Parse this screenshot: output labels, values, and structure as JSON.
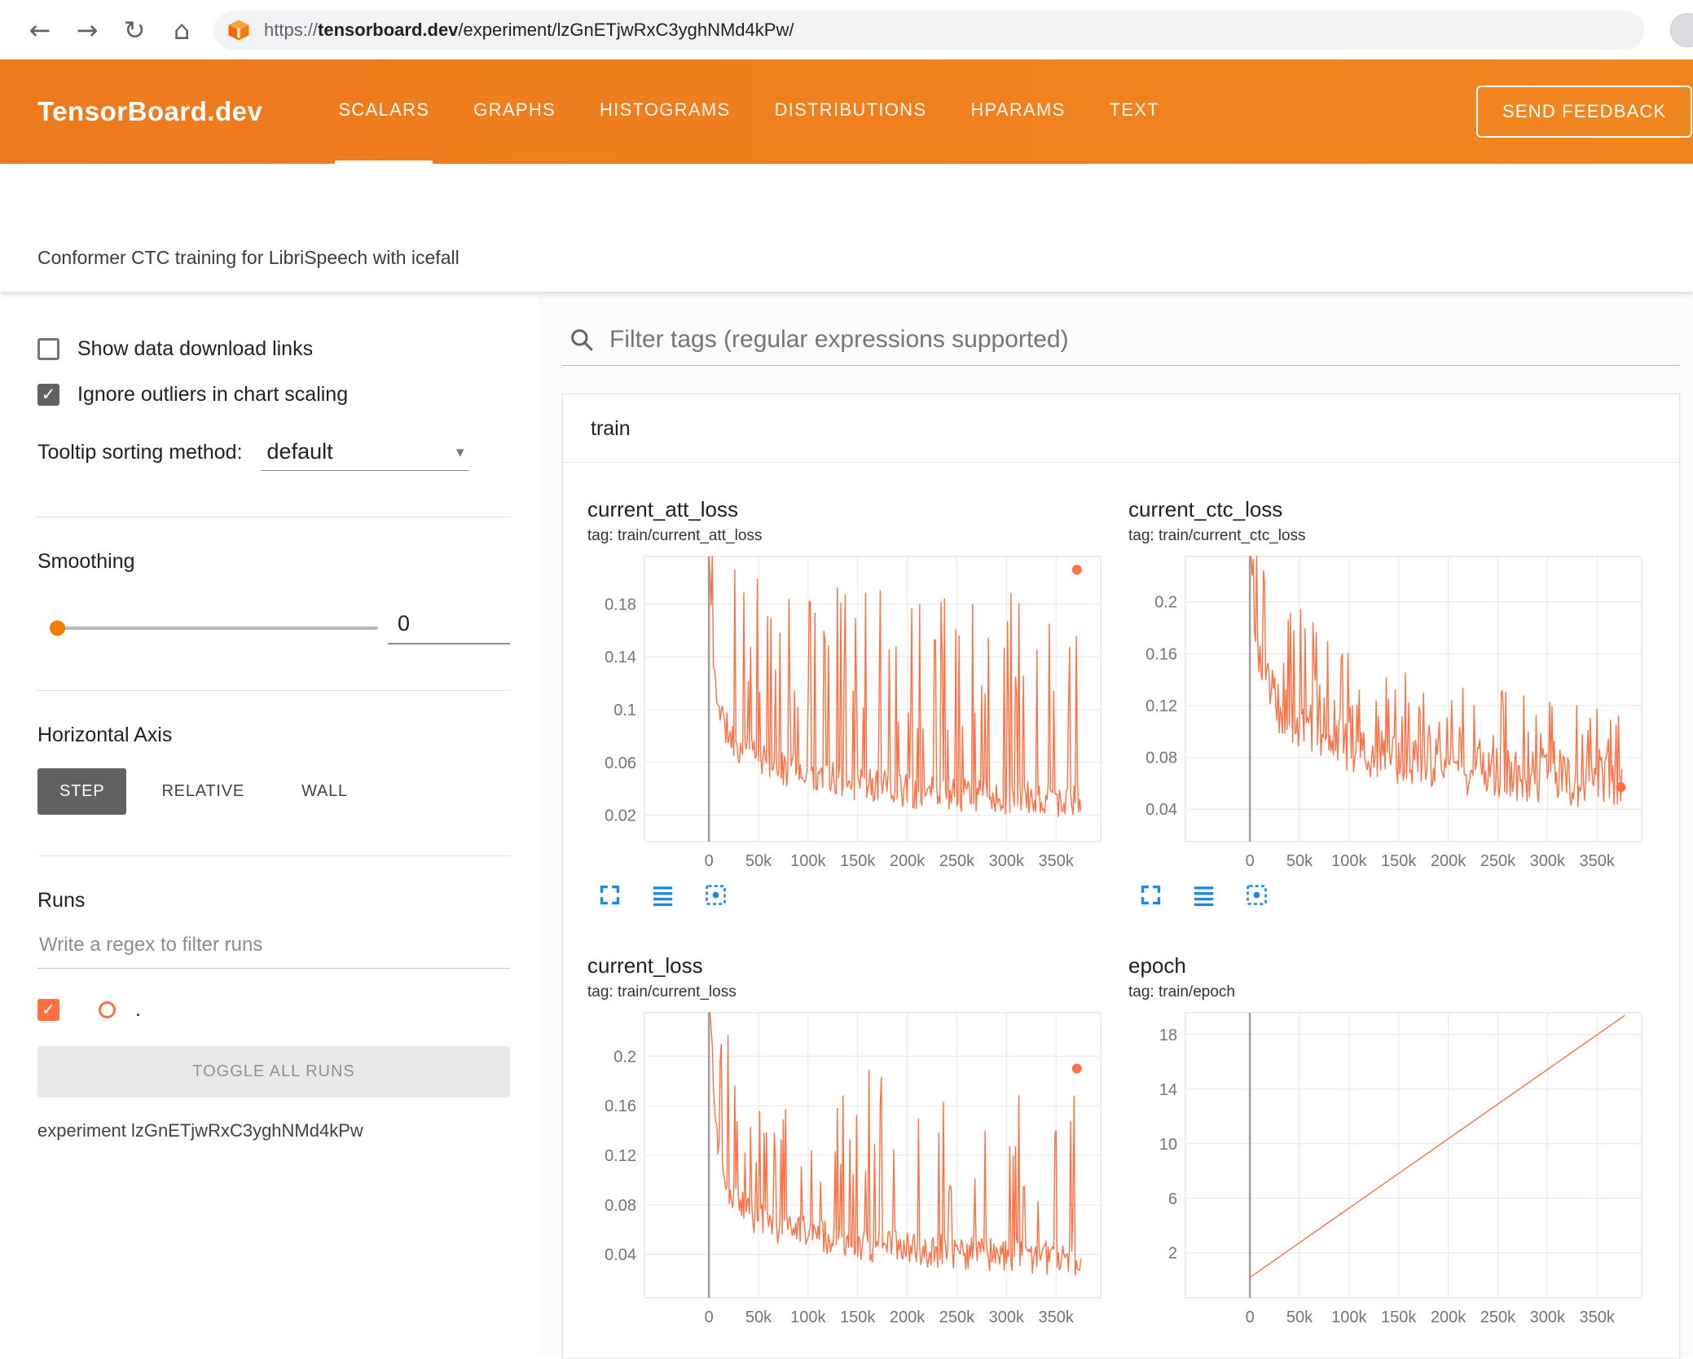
{
  "browser": {
    "back": "←",
    "forward": "→",
    "reload": "↻",
    "home": "⌂",
    "url_scheme": "https://",
    "url_domain": "tensorboard.dev",
    "url_path": "/experiment/lzGnETjwRxC3yghNMd4kPw/"
  },
  "header": {
    "logo": "TensorBoard.dev",
    "tabs": [
      {
        "label": "SCALARS",
        "active": true
      },
      {
        "label": "GRAPHS",
        "active": false
      },
      {
        "label": "HISTOGRAMS",
        "active": false
      },
      {
        "label": "DISTRIBUTIONS",
        "active": false
      },
      {
        "label": "HPARAMS",
        "active": false
      },
      {
        "label": "TEXT",
        "active": false
      }
    ],
    "feedback_button": "SEND FEEDBACK"
  },
  "experiment_title": "Conformer CTC training for LibriSpeech with icefall",
  "sidebar": {
    "show_download_label": "Show data download links",
    "show_download_checked": false,
    "ignore_outliers_label": "Ignore outliers in chart scaling",
    "ignore_outliers_checked": true,
    "tooltip_label": "Tooltip sorting method:",
    "tooltip_value": "default",
    "dropdown_caret": "▾",
    "smoothing_label": "Smoothing",
    "smoothing_value": "0",
    "axis_label": "Horizontal Axis",
    "axis_options": [
      {
        "label": "STEP",
        "selected": true
      },
      {
        "label": "RELATIVE",
        "selected": false
      },
      {
        "label": "WALL",
        "selected": false
      }
    ],
    "runs_label": "Runs",
    "runs_filter_placeholder": "Write a regex to filter runs",
    "run_checked": true,
    "run_name": ".",
    "toggle_all_label": "TOGGLE ALL RUNS",
    "experiment_caption": "experiment lzGnETjwRxC3yghNMd4kPw"
  },
  "main": {
    "filter_placeholder": "Filter tags (regular expressions supported)",
    "group_title": "train",
    "chart_toolbar_icons": [
      "expand-icon",
      "data-rows-icon",
      "fit-domain-icon"
    ]
  },
  "colors": {
    "header_orange": "#f0811f",
    "run_color": "#ff7043",
    "toolbar_icon_blue": "#1e88e5",
    "grid_line": "#e6e6e6",
    "zero_axis": "#9e9e9e",
    "tick_text": "#757575"
  },
  "chart_data": [
    {
      "type": "line",
      "title": "current_att_loss",
      "tag": "tag: train/current_att_loss",
      "x_tick_labels": [
        "0",
        "50k",
        "100k",
        "150k",
        "200k",
        "250k",
        "300k",
        "350k"
      ],
      "x_tick_values": [
        0,
        50000,
        100000,
        150000,
        200000,
        250000,
        300000,
        350000
      ],
      "x_domain": [
        -65000,
        395000
      ],
      "y_tick_labels": [
        "0.18",
        "0.14",
        "0.1",
        "0.06",
        "0.02"
      ],
      "y_tick_values": [
        0.18,
        0.14,
        0.1,
        0.06,
        0.02
      ],
      "y_domain": [
        0.0,
        0.216
      ],
      "series": {
        "name": "train",
        "color": "#ff7043",
        "x_end": 375000,
        "n": 330,
        "seed": 11,
        "baseline": [
          [
            0,
            0.22
          ],
          [
            5000,
            0.12
          ],
          [
            15000,
            0.085
          ],
          [
            30000,
            0.068
          ],
          [
            60000,
            0.055
          ],
          [
            100000,
            0.047
          ],
          [
            150000,
            0.04
          ],
          [
            220000,
            0.033
          ],
          [
            300000,
            0.03
          ],
          [
            375000,
            0.027
          ]
        ],
        "spike_amp": [
          [
            0,
            0.13
          ],
          [
            20000,
            0.15
          ],
          [
            375000,
            0.17
          ]
        ],
        "spike_prob": 0.17,
        "jitter": 0.013,
        "end_dot": [
          371000,
          0.206
        ]
      }
    },
    {
      "type": "line",
      "title": "current_ctc_loss",
      "tag": "tag: train/current_ctc_loss",
      "x_tick_labels": [
        "0",
        "50k",
        "100k",
        "150k",
        "200k",
        "250k",
        "300k",
        "350k"
      ],
      "x_tick_values": [
        0,
        50000,
        100000,
        150000,
        200000,
        250000,
        300000,
        350000
      ],
      "x_domain": [
        -65000,
        395000
      ],
      "y_tick_labels": [
        "0.2",
        "0.16",
        "0.12",
        "0.08",
        "0.04"
      ],
      "y_tick_values": [
        0.2,
        0.16,
        0.12,
        0.08,
        0.04
      ],
      "y_domain": [
        0.015,
        0.235
      ],
      "series": {
        "name": "train",
        "color": "#ff7043",
        "x_end": 375000,
        "n": 330,
        "seed": 23,
        "baseline": [
          [
            0,
            0.26
          ],
          [
            6000,
            0.17
          ],
          [
            15000,
            0.135
          ],
          [
            30000,
            0.112
          ],
          [
            60000,
            0.096
          ],
          [
            100000,
            0.083
          ],
          [
            150000,
            0.073
          ],
          [
            220000,
            0.064
          ],
          [
            300000,
            0.058
          ],
          [
            375000,
            0.053
          ]
        ],
        "spike_amp": [
          [
            0,
            0.1
          ],
          [
            60000,
            0.095
          ],
          [
            150000,
            0.075
          ],
          [
            375000,
            0.065
          ]
        ],
        "spike_prob": 0.2,
        "jitter": 0.02,
        "end_dot": [
          374000,
          0.057
        ]
      }
    },
    {
      "type": "line",
      "title": "current_loss",
      "tag": "tag: train/current_loss",
      "x_tick_labels": [
        "0",
        "50k",
        "100k",
        "150k",
        "200k",
        "250k",
        "300k",
        "350k"
      ],
      "x_tick_values": [
        0,
        50000,
        100000,
        150000,
        200000,
        250000,
        300000,
        350000
      ],
      "x_domain": [
        -65000,
        395000
      ],
      "y_tick_labels": [
        "0.2",
        "0.16",
        "0.12",
        "0.08",
        "0.04"
      ],
      "y_tick_values": [
        0.2,
        0.16,
        0.12,
        0.08,
        0.04
      ],
      "y_domain": [
        0.005,
        0.235
      ],
      "series": {
        "name": "train",
        "color": "#ff7043",
        "x_end": 375000,
        "n": 330,
        "seed": 37,
        "baseline": [
          [
            0,
            0.26
          ],
          [
            6000,
            0.14
          ],
          [
            15000,
            0.095
          ],
          [
            30000,
            0.074
          ],
          [
            60000,
            0.061
          ],
          [
            100000,
            0.052
          ],
          [
            150000,
            0.045
          ],
          [
            220000,
            0.039
          ],
          [
            300000,
            0.035
          ],
          [
            375000,
            0.032
          ]
        ],
        "spike_amp": [
          [
            0,
            0.13
          ],
          [
            60000,
            0.15
          ],
          [
            375000,
            0.16
          ]
        ],
        "spike_prob": 0.16,
        "jitter": 0.014,
        "end_dot": [
          371000,
          0.19
        ]
      }
    },
    {
      "type": "line",
      "title": "epoch",
      "tag": "tag: train/epoch",
      "x_tick_labels": [
        "0",
        "50k",
        "100k",
        "150k",
        "200k",
        "250k",
        "300k",
        "350k"
      ],
      "x_tick_values": [
        0,
        50000,
        100000,
        150000,
        200000,
        250000,
        300000,
        350000
      ],
      "x_domain": [
        -65000,
        395000
      ],
      "y_tick_labels": [
        "18",
        "14",
        "10",
        "6",
        "2"
      ],
      "y_tick_values": [
        18,
        14,
        10,
        6,
        2
      ],
      "y_domain": [
        -1.3,
        19.6
      ],
      "series": {
        "name": "train",
        "color": "#ff7043",
        "line": [
          [
            0,
            0.2
          ],
          [
            378000,
            19.4
          ]
        ]
      }
    }
  ]
}
